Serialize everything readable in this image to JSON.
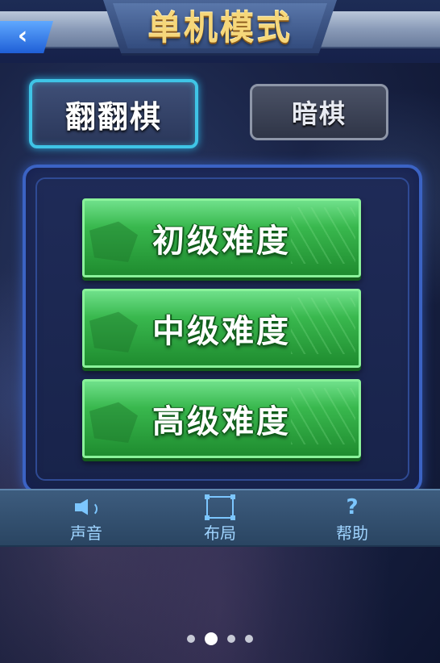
{
  "header": {
    "title": "单机模式",
    "back_icon": "chevron-left-icon"
  },
  "modes": {
    "tabs": [
      {
        "label": "翻翻棋",
        "active": true
      },
      {
        "label": "暗棋",
        "active": false
      }
    ]
  },
  "difficulty": {
    "buttons": [
      {
        "label": "初级难度"
      },
      {
        "label": "中级难度"
      },
      {
        "label": "高级难度"
      }
    ]
  },
  "bottom_bar": {
    "items": [
      {
        "label": "声音",
        "icon": "speaker-icon"
      },
      {
        "label": "布局",
        "icon": "layout-icon"
      },
      {
        "label": "帮助",
        "icon": "help-icon",
        "glyph": "?"
      }
    ]
  },
  "pagination": {
    "count": 4,
    "active_index": 1
  },
  "colors": {
    "accent": "#3fc4e6",
    "button_green": "#39b84e",
    "title_gold": "#f6d77a",
    "bar_text": "#9fd4ff"
  }
}
